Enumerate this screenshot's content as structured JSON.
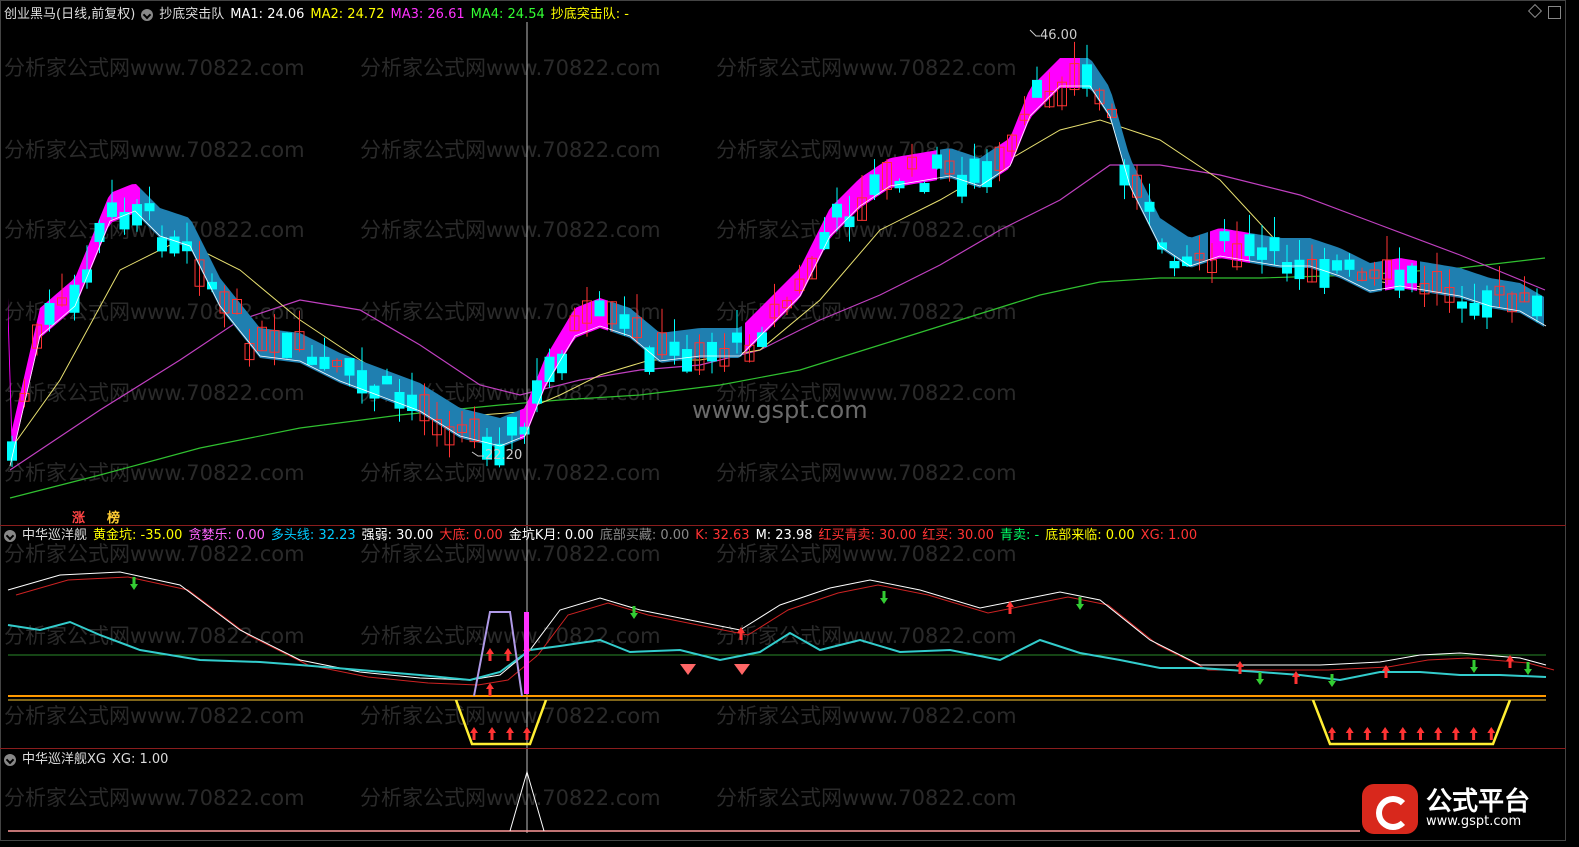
{
  "main_panel": {
    "stock_name": "创业黑马(日线,前复权)",
    "indicator_name": "抄底突击队",
    "ma1_label": "MA1: 24.06",
    "ma2_label": "MA2: 24.72",
    "ma3_label": "MA3: 26.61",
    "ma4_label": "MA4: 24.54",
    "signal_label": "抄底突击队: -",
    "high_label": "46.00",
    "low_label": "22.20",
    "tag1": "涨",
    "tag2": "榜",
    "center_watermark": "www.gspt.com"
  },
  "sub_panel_1": {
    "name": "中华巡洋舰",
    "items": [
      {
        "text": "黄金坑: -35.00",
        "color": "#ffff00"
      },
      {
        "text": "贪婪乐: 0.00",
        "color": "#ff66ff"
      },
      {
        "text": "多头线: 32.23",
        "color": "#00ccff"
      },
      {
        "text": "强弱: 30.00",
        "color": "#ffffff"
      },
      {
        "text": "大底: 0.00",
        "color": "#ff3333"
      },
      {
        "text": "金坑K月: 0.00",
        "color": "#ffffff"
      },
      {
        "text": "底部买藏: 0.00",
        "color": "#888888"
      },
      {
        "text": "K: 32.63",
        "color": "#ff3333"
      },
      {
        "text": "M: 23.98",
        "color": "#ffffff"
      },
      {
        "text": "红买青卖: 30.00",
        "color": "#ff3333"
      },
      {
        "text": "红买: 30.00",
        "color": "#ff3333"
      },
      {
        "text": "青卖: -",
        "color": "#00ff66"
      },
      {
        "text": "底部来临: 0.00",
        "color": "#ffff00"
      },
      {
        "text": "XG: 1.00",
        "color": "#ff3333"
      }
    ]
  },
  "sub_panel_2": {
    "name": "中华巡洋舰XG",
    "xg_label": "XG: 1.00"
  },
  "watermark_text": "分析家公式网www.70822.com",
  "logo": {
    "title": "公式平台",
    "url": "www.gspt.com"
  },
  "colors": {
    "up": "#ff3333",
    "down": "#00ffff",
    "ribbon_up": "#ff00ff",
    "ribbon_down": "#1f7fb0",
    "ma1": "#ffffff",
    "ma2": "#e8e070",
    "ma3": "#c040c0",
    "ma4": "#30c030"
  }
}
